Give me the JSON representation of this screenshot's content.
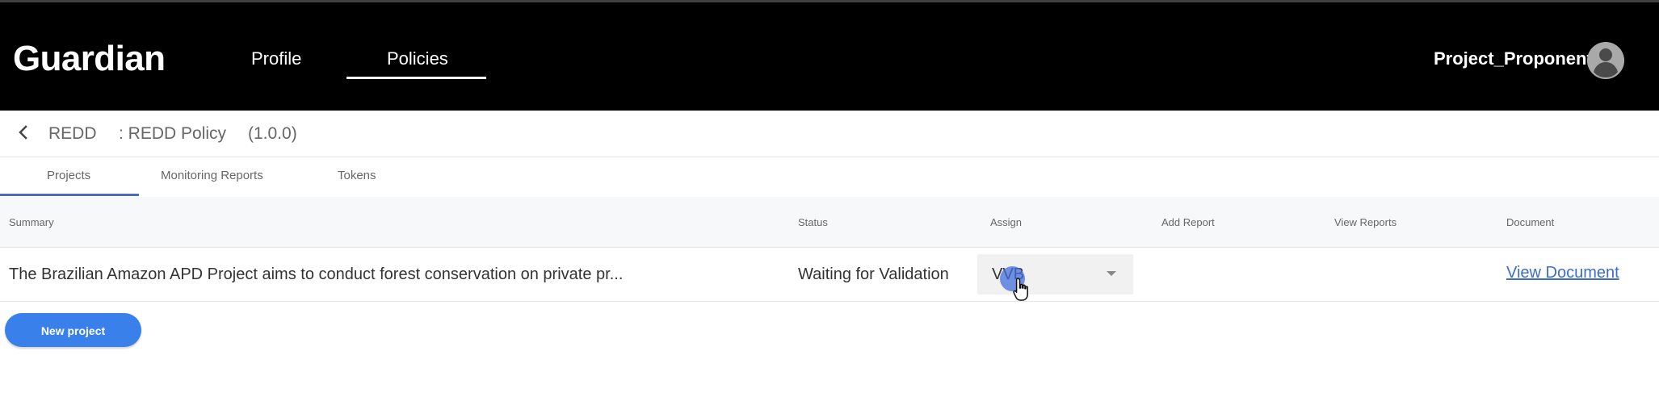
{
  "app": {
    "brand": "Guardian",
    "colors": {
      "header_background": "#000000",
      "primary_button": "#3a80eb",
      "link": "#3d6ccf",
      "tab_indicator": "#4a6dbf"
    }
  },
  "header": {
    "nav": {
      "profile": "Profile",
      "policies": "Policies"
    },
    "active_nav": "Policies",
    "user": {
      "name": "Project_Proponent",
      "avatar_icon": "account-circle-icon"
    }
  },
  "policy_bar": {
    "back_icon": "chevron-left-icon",
    "name": "REDD",
    "description": ": REDD Policy",
    "version": "(1.0.0)"
  },
  "tabs": {
    "items": [
      "Projects",
      "Monitoring Reports",
      "Tokens"
    ],
    "active": "Projects"
  },
  "table": {
    "headers": {
      "summary": "Summary",
      "status": "Status",
      "assign": "Assign",
      "add_report": "Add Report",
      "view_reports": "View Reports",
      "document": "Document"
    },
    "rows": [
      {
        "summary": "The Brazilian Amazon APD Project aims to conduct forest conservation on private pr...",
        "status": "Waiting for Validation",
        "assign": "VVB",
        "add_report": "",
        "view_reports": "",
        "document_link": "View Document"
      }
    ]
  },
  "actions": {
    "new_project": "New project"
  },
  "cursor": {
    "icon": "hand-pointer-icon"
  }
}
